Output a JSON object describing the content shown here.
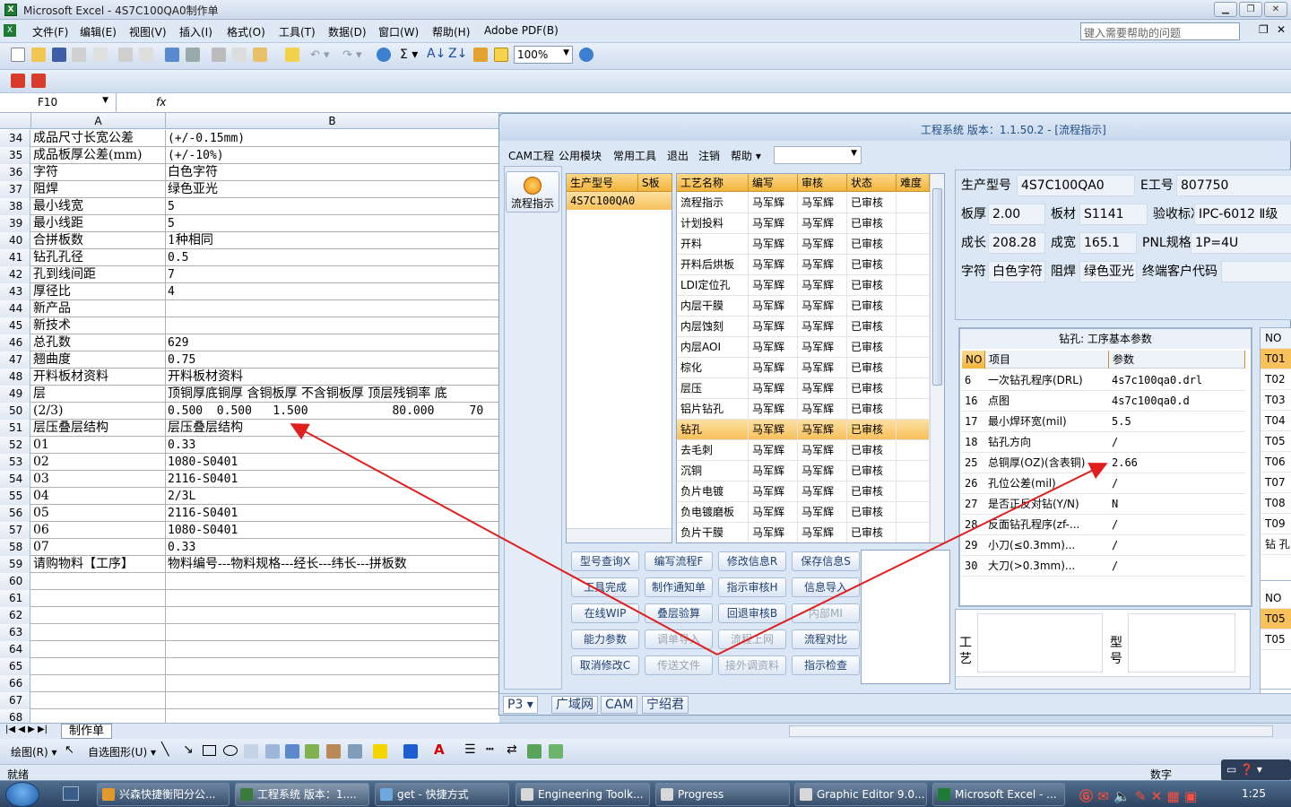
{
  "excel": {
    "title": "Microsoft Excel - 4S7C100QA0制作单",
    "menu": [
      "文件(F)",
      "编辑(E)",
      "视图(V)",
      "插入(I)",
      "格式(O)",
      "工具(T)",
      "数据(D)",
      "窗口(W)",
      "帮助(H)",
      "Adobe PDF(B)"
    ],
    "help_placeholder": "键入需要帮助的问题",
    "zoom": "100%",
    "name_box": "F10",
    "fx": "fx",
    "col_a": "A",
    "col_b": "B",
    "sheet_tab": "制作单",
    "status_left": "就绪",
    "status_right": "数字",
    "draw_label": "绘图(R)",
    "autoshape_label": "自选图形(U)",
    "rows": [
      {
        "n": "34",
        "a": "成品尺寸长宽公差",
        "b": "(+/-0.15mm)"
      },
      {
        "n": "35",
        "a": "成品板厚公差(mm)",
        "b": "(+/-10%)"
      },
      {
        "n": "36",
        "a": "字符",
        "b": "白色字符"
      },
      {
        "n": "37",
        "a": "阻焊",
        "b": "绿色亚光"
      },
      {
        "n": "38",
        "a": "最小线宽",
        "b": "5"
      },
      {
        "n": "39",
        "a": "最小线距",
        "b": "5"
      },
      {
        "n": "40",
        "a": "合拼板数",
        "b": "1种相同"
      },
      {
        "n": "41",
        "a": "钻孔孔径",
        "b": "0.5"
      },
      {
        "n": "42",
        "a": "孔到线间距",
        "b": "7"
      },
      {
        "n": "43",
        "a": "厚径比",
        "b": "4"
      },
      {
        "n": "44",
        "a": "新产品",
        "b": ""
      },
      {
        "n": "45",
        "a": "新技术",
        "b": ""
      },
      {
        "n": "46",
        "a": "总孔数",
        "b": "629"
      },
      {
        "n": "47",
        "a": "翘曲度",
        "b": "0.75"
      },
      {
        "n": "48",
        "a": "开料板材资料",
        "b": "开料板材资料"
      },
      {
        "n": "49",
        "a": "层",
        "b": "顶铜厚底铜厚 含铜板厚 不含铜板厚 顶层残铜率 底"
      },
      {
        "n": "50",
        "a": "(2/3)",
        "b": "0.500  0.500   1.500            80.000     70"
      },
      {
        "n": "51",
        "a": "层压叠层结构",
        "b": "层压叠层结构"
      },
      {
        "n": "52",
        "a": "01",
        "b": "0.33"
      },
      {
        "n": "53",
        "a": "02",
        "b": "1080-S0401"
      },
      {
        "n": "54",
        "a": "03",
        "b": "2116-S0401"
      },
      {
        "n": "55",
        "a": "04",
        "b": "2/3L"
      },
      {
        "n": "56",
        "a": "05",
        "b": "2116-S0401"
      },
      {
        "n": "57",
        "a": "06",
        "b": "1080-S0401"
      },
      {
        "n": "58",
        "a": "07",
        "b": "0.33"
      },
      {
        "n": "59",
        "a": "请购物料【工序】",
        "b": "物料编号---物料规格---经长---纬长---拼板数"
      },
      {
        "n": "60",
        "a": "",
        "b": ""
      },
      {
        "n": "61",
        "a": "",
        "b": ""
      },
      {
        "n": "62",
        "a": "",
        "b": ""
      },
      {
        "n": "63",
        "a": "",
        "b": ""
      },
      {
        "n": "64",
        "a": "",
        "b": ""
      },
      {
        "n": "65",
        "a": "",
        "b": ""
      },
      {
        "n": "66",
        "a": "",
        "b": ""
      },
      {
        "n": "67",
        "a": "",
        "b": ""
      },
      {
        "n": "68",
        "a": "",
        "b": ""
      }
    ]
  },
  "eng": {
    "title": "工程系统   版本：1.1.50.2 - [流程指示]",
    "menu": [
      "CAM工程",
      "公用模块",
      "常用工具",
      "退出",
      "注销",
      "帮助"
    ],
    "flow_btn": "流程指示",
    "model_headers": [
      "生产型号",
      "S板"
    ],
    "model_value": "4S7C100QA0",
    "proc_headers": [
      "工艺名称",
      "编写",
      "审核",
      "状态",
      "难度"
    ],
    "proc_rows": [
      [
        "流程指示",
        "马军辉",
        "马军辉",
        "已审核"
      ],
      [
        "计划投料",
        "马军辉",
        "马军辉",
        "已审核"
      ],
      [
        "开料",
        "马军辉",
        "马军辉",
        "已审核"
      ],
      [
        "开料后烘板",
        "马军辉",
        "马军辉",
        "已审核"
      ],
      [
        "LDI定位孔",
        "马军辉",
        "马军辉",
        "已审核"
      ],
      [
        "内层干膜",
        "马军辉",
        "马军辉",
        "已审核"
      ],
      [
        "内层蚀刻",
        "马军辉",
        "马军辉",
        "已审核"
      ],
      [
        "内层AOI",
        "马军辉",
        "马军辉",
        "已审核"
      ],
      [
        "棕化",
        "马军辉",
        "马军辉",
        "已审核"
      ],
      [
        "层压",
        "马军辉",
        "马军辉",
        "已审核"
      ],
      [
        "铝片钻孔",
        "马军辉",
        "马军辉",
        "已审核"
      ],
      [
        "钻孔",
        "马军辉",
        "马军辉",
        "已审核"
      ],
      [
        "去毛刺",
        "马军辉",
        "马军辉",
        "已审核"
      ],
      [
        "沉铜",
        "马军辉",
        "马军辉",
        "已审核"
      ],
      [
        "负片电镀",
        "马军辉",
        "马军辉",
        "已审核"
      ],
      [
        "负电镀磨板",
        "马军辉",
        "马军辉",
        "已审核"
      ],
      [
        "负片干膜",
        "马军辉",
        "马军辉",
        "已审核"
      ]
    ],
    "buttons": [
      [
        "型号查询X",
        "编写流程F",
        "修改信息R",
        "保存信息S"
      ],
      [
        "工具完成",
        "制作通知单",
        "指示审核H",
        "信息导入"
      ],
      [
        "在线WIP",
        "叠层验算",
        "回退审核B",
        "内部MI"
      ],
      [
        "能力参数",
        "调单导入",
        "流程上网",
        "流程对比"
      ],
      [
        "取消修改C",
        "传送文件",
        "接外调资料",
        "指示检查"
      ]
    ],
    "info": {
      "model_label": "生产型号",
      "model": "4S7C100QA0",
      "eno_label": "E工号",
      "eno": "807750",
      "thick_label": "板厚",
      "thick": "2.00",
      "mat_label": "板材",
      "mat": "S1141",
      "std_label": "验收标准",
      "std": "IPC-6012 Ⅱ级",
      "len_label": "成长",
      "len": "208.28",
      "wid_label": "成宽",
      "wid": "165.1",
      "pnl_label": "PNL规格",
      "pnl": "1P=4U",
      "char_label": "字符",
      "char": "白色字符",
      "mask_label": "阻焊",
      "mask": "绿色亚光",
      "cust_label": "终端客户代码"
    },
    "drill_title": "钻孔: 工序基本参数",
    "drill_headers": [
      "NO",
      "项目",
      "参数"
    ],
    "drill_rows": [
      [
        "6",
        "一次钻孔程序(DRL)",
        "4s7c100qa0.drl"
      ],
      [
        "16",
        "点图",
        "4s7c100qa0.d"
      ],
      [
        "17",
        "最小焊环宽(mil)",
        "5.5"
      ],
      [
        "18",
        "钻孔方向",
        "/"
      ],
      [
        "25",
        "总铜厚(OZ)(含表铜)",
        "2.66"
      ],
      [
        "26",
        "孔位公差(mil)",
        "/"
      ],
      [
        "27",
        "是否正反对钻(Y/N)",
        "N"
      ],
      [
        "28",
        "反面钻孔程序(zf-...",
        "/"
      ],
      [
        "29",
        "小刀(≤0.3mm)...",
        "/"
      ],
      [
        "30",
        "大刀(>0.3mm)...",
        "/"
      ]
    ],
    "tlist": [
      "NO",
      "T01",
      "T02",
      "T03",
      "T04",
      "T05",
      "T06",
      "T07",
      "T08",
      "T09",
      "钻 孔"
    ],
    "tlist2": [
      "NO",
      "T05",
      "T05"
    ],
    "low_labels": [
      "工艺",
      "型号"
    ],
    "tabs": [
      "P3",
      "广域网",
      "CAM",
      "宁绍君"
    ]
  },
  "taskbar": {
    "items": [
      "兴森快捷衡阳分公...",
      "工程系统  版本：1....",
      "get - 快捷方式",
      "Engineering Toolk...",
      "Progress",
      "Graphic Editor 9.0...",
      "Microsoft Excel - ..."
    ],
    "clock": "1:25"
  }
}
